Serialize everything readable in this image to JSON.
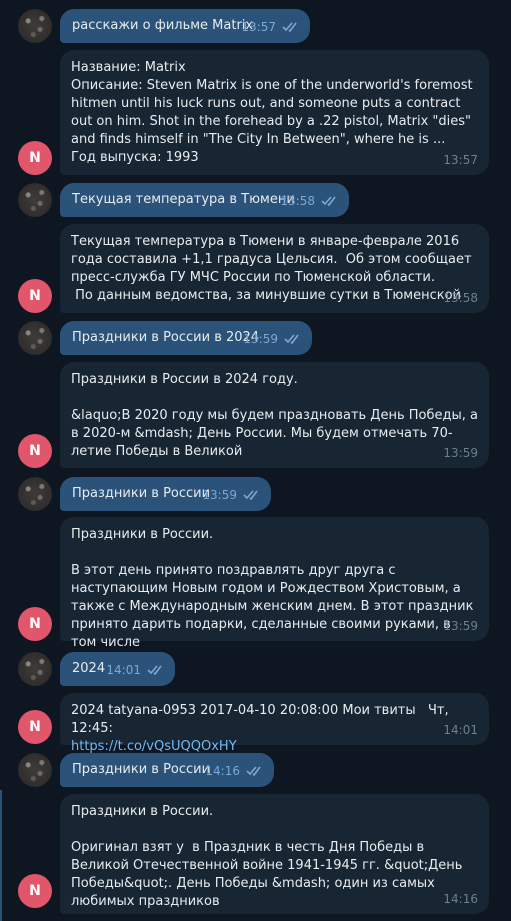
{
  "messages": [
    {
      "user": "расскажи о фильме Matrix",
      "user_time": "13:57",
      "bot_lines": [
        "Название: Matrix",
        "Описание: Steven Matrix is one of the underworld's foremost hitmen until his luck runs out, and someone puts a contract out on him. Shot in the forehead by a .22 pistol, Matrix \"dies\" and finds himself in \"The City In Between\", where he is ...",
        "Год выпуска: 1993"
      ],
      "bot_time": "13:57"
    },
    {
      "user": "Текущая температура в Тюмени",
      "user_time": "13:58",
      "bot_text": "Текущая температура в Тюмени в январе-феврале 2016 года составила +1,1 градуса Цельсия.  Об этом сообщает пресс-служба ГУ МЧС России по Тюменской области.\n По данным ведомства, за минувшие сутки в Тюменской",
      "bot_time": "13:58"
    },
    {
      "user": "Праздники в России в 2024",
      "user_time": "13:59",
      "bot_text": "Праздники в России в 2024 году.\n\n&laquo;В 2020 году мы будем праздновать День Победы, а в 2020-м &mdash; День России. Мы будем отмечать 70-летие Победы в Великой",
      "bot_time": "13:59"
    },
    {
      "user": "Праздники в России",
      "user_time": "13:59",
      "bot_text": "Праздники в России.\n\nВ этот день принято поздравлять друг друга с наступающим Новым годом и Рождеством Христовым, а также с Международным женским днем. В этот праздник принято дарить подарки, сделанные своими руками, в том числе",
      "bot_time": "13:59"
    },
    {
      "user": "2024",
      "user_time": "14:01",
      "bot_text": "2024 tatyana-0953 2017-04-10 20:08:00 Мои твиты   Чт, 12:45:",
      "bot_link": "https://t.co/vQsUQQOxHY",
      "bot_time": "14:01"
    },
    {
      "user": "Праздники в России",
      "user_time": "14:16",
      "bot_text": "Праздники в России.\n\nОригинал взят у  в Праздник в честь Дня Победы в Великой Отечественной войне 1941-1945 гг. &quot;День Победы&quot;. День Победы &mdash; один из самых любимых праздников",
      "bot_time": "14:16"
    }
  ],
  "bot_avatar_letter": "N",
  "colors": {
    "background": "#0e1621",
    "outgoing": "#2b5278",
    "incoming": "#182533",
    "avatar": "#e2566b",
    "link": "#71baf3"
  },
  "icons": {
    "read_status": "double-check-icon",
    "user_avatar": "user-avatar-photo"
  }
}
